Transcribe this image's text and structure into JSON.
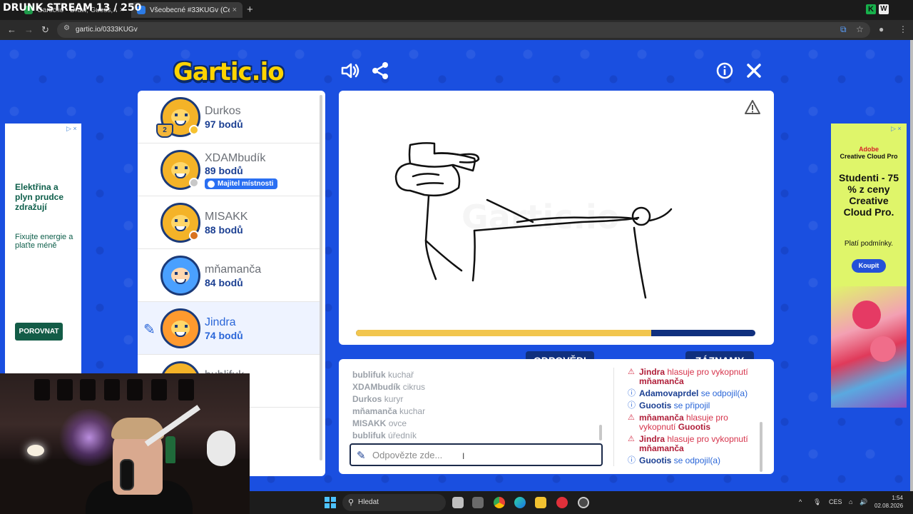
{
  "stream": {
    "title": "DRUNK STREAM 13 / 250"
  },
  "browser": {
    "tabs": [
      {
        "label": "Gartic.io - Draw, Guess, WIN"
      },
      {
        "label": "Všeobecné #33KUGv (Čeština)"
      }
    ],
    "url": "gartic.io/0333KUGv",
    "new_tab": "+",
    "close": "×"
  },
  "game": {
    "logo": "Gartic.io",
    "players": [
      {
        "name": "Durkos",
        "points": "97 bodů",
        "badge": "",
        "rank": "2",
        "status_color": "#f6c230"
      },
      {
        "name": "XDAMbudík",
        "points": "89 bodů",
        "badge": "Majitel místnosti",
        "status_color": "#c8c8c8"
      },
      {
        "name": "MISAKK",
        "points": "88 bodů",
        "status_color": "#d9731f"
      },
      {
        "name": "mňamanča",
        "points": "84 bodů"
      },
      {
        "name": "Jindra",
        "points": "74 bodů"
      },
      {
        "name": "bublifuk",
        "points": ""
      }
    ],
    "timer_fraction": 0.74,
    "tabs": {
      "answers": "ODPOVĚDI",
      "logs": "ZÁZNAMY"
    },
    "answers": [
      {
        "name": "bublifuk",
        "text": "kuchař"
      },
      {
        "name": "XDAMbudík",
        "text": "cikrus"
      },
      {
        "name": "Durkos",
        "text": "kuryr"
      },
      {
        "name": "mňamanča",
        "text": "kuchar"
      },
      {
        "name": "MISAKK",
        "text": "ovce"
      },
      {
        "name": "bublifuk",
        "text": "úředník"
      }
    ],
    "input_placeholder": "Odpovězte zde...",
    "logs": [
      {
        "type": "warn",
        "who": "Jindra",
        "text": " hlasuje pro vykopnutí ",
        "target": "mňamanča"
      },
      {
        "type": "info",
        "who": "Adamovaprdel",
        "text": " se odpojil(a)"
      },
      {
        "type": "info",
        "who": "Guootis",
        "text": " se připojil"
      },
      {
        "type": "warn",
        "who": "mňamanča",
        "text": " hlasuje pro vykopnutí ",
        "target": "Guootis"
      },
      {
        "type": "warn",
        "who": "Jindra",
        "text": " hlasuje pro vykopnutí ",
        "target": "mňamanča"
      },
      {
        "type": "info",
        "who": "Guootis",
        "text": " se odpojil(a)"
      }
    ]
  },
  "ads": {
    "left": {
      "headline": "Elektřina a plyn prudce zdražují",
      "sub": "Fixujte energie a plaťte méně",
      "button": "POROVNAT"
    },
    "right": {
      "brand": "Adobe",
      "product": "Creative Cloud Pro",
      "headline": "Studenti - 75 % z ceny Creative Cloud Pro.",
      "sub": "Platí podmínky.",
      "button": "Koupit"
    }
  },
  "taskbar": {
    "search": "Hledat",
    "lang": "CES",
    "time": "1:54",
    "date": "02.08.2026"
  }
}
